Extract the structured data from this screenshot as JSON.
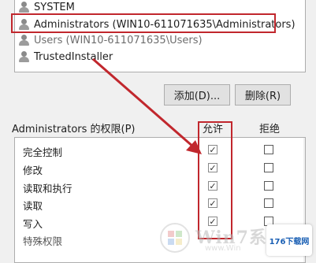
{
  "users": [
    {
      "name": "SYSTEM"
    },
    {
      "name": "Administrators (WIN10-611071635\\Administrators)"
    },
    {
      "name": "Users (WIN10-611071635\\Users)"
    },
    {
      "name": "TrustedInstaller"
    }
  ],
  "buttons": {
    "add_label": "添加(D)...",
    "remove_label": "删除(R)"
  },
  "permissions": {
    "header": "Administrators 的权限(P)",
    "allow_col": "允许",
    "deny_col": "拒绝",
    "rows": [
      {
        "label": "完全控制",
        "allow": true,
        "deny": false
      },
      {
        "label": "修改",
        "allow": true,
        "deny": false
      },
      {
        "label": "读取和执行",
        "allow": true,
        "deny": false
      },
      {
        "label": "读取",
        "allow": true,
        "deny": false
      },
      {
        "label": "写入",
        "allow": true,
        "deny": false
      },
      {
        "label": "特殊权限",
        "allow": false,
        "deny": false
      }
    ]
  },
  "checkmark": "✓",
  "watermarks": {
    "main": "Win7系",
    "sub": "www.Win",
    "site": "176下载网"
  },
  "colors": {
    "annotation": "#c1272d"
  }
}
